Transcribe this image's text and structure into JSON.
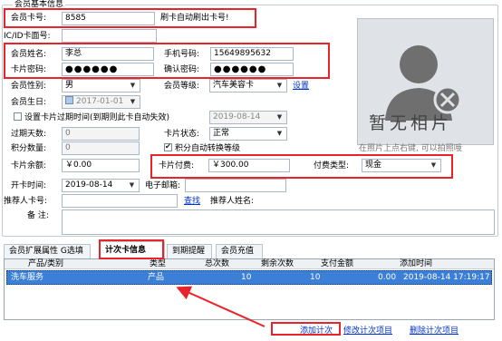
{
  "section_title": "会员基本信息",
  "labels": {
    "member_card_no": "会员卡号:",
    "auto_swipe_hint": "刷卡自动刷出卡号!",
    "ic_id_card_no": "IC/ID卡面号:",
    "member_name": "会员姓名:",
    "phone": "手机号码:",
    "card_password": "卡片密码:",
    "confirm_password": "确认密码:",
    "gender": "会员性别:",
    "level": "会员等级:",
    "birthday": "会员生日:",
    "set_expiry": "设置卡片过期时间(到期则此卡自动失效)",
    "expired_days": "过期天数:",
    "card_status": "卡片状态:",
    "points": "积分数量:",
    "points_auto": "积分自动转换等级",
    "balance": "卡片余额:",
    "payment": "卡片付费:",
    "pay_type": "付费类型:",
    "open_time": "开卡时间:",
    "email": "电子邮箱:",
    "referrer_card": "推荐人卡号:",
    "referrer_name": "推荐人姓名:",
    "remark": "备 注:"
  },
  "values": {
    "member_card_no": "8585",
    "ic_id_card_no": "",
    "member_name": "李总",
    "phone": "15649895632",
    "card_password": "●●●●●●",
    "confirm_password": "●●●●●●",
    "gender": "男",
    "level": "汽车美容卡",
    "birthday": "2017-01-01",
    "expiry_date": "2019-08-14",
    "expired_days": "0",
    "card_status": "正常",
    "points": "0",
    "balance": "￥0.00",
    "payment": "￥300.00",
    "pay_type": "现金",
    "open_time": "2019-08-14",
    "email": "",
    "referrer_card": "",
    "remark": ""
  },
  "links": {
    "set_level": "设置",
    "lookup": "查找"
  },
  "photo": {
    "placeholder": "暂无相片",
    "hint": "在照片上点右键, 可以拍照哦"
  },
  "tabs": [
    "会员扩展属性 G选填",
    "计次卡信息",
    "到期提醒",
    "会员充值"
  ],
  "table": {
    "headers": [
      "产品/类别",
      "类型",
      "总次数",
      "剩余次数",
      "支付金额",
      "添加时间"
    ],
    "rows": [
      [
        "洗车服务",
        "产品",
        "10",
        "10",
        "0.00",
        "2019-08-14 17:19:17"
      ]
    ]
  },
  "actions": {
    "add": "添加计次",
    "modify": "修改计次项目",
    "delete": "删除计次项目"
  },
  "colors": {
    "highlight": "#e8232a",
    "selected_row": "#3b7fd6",
    "link": "#0033cc"
  }
}
